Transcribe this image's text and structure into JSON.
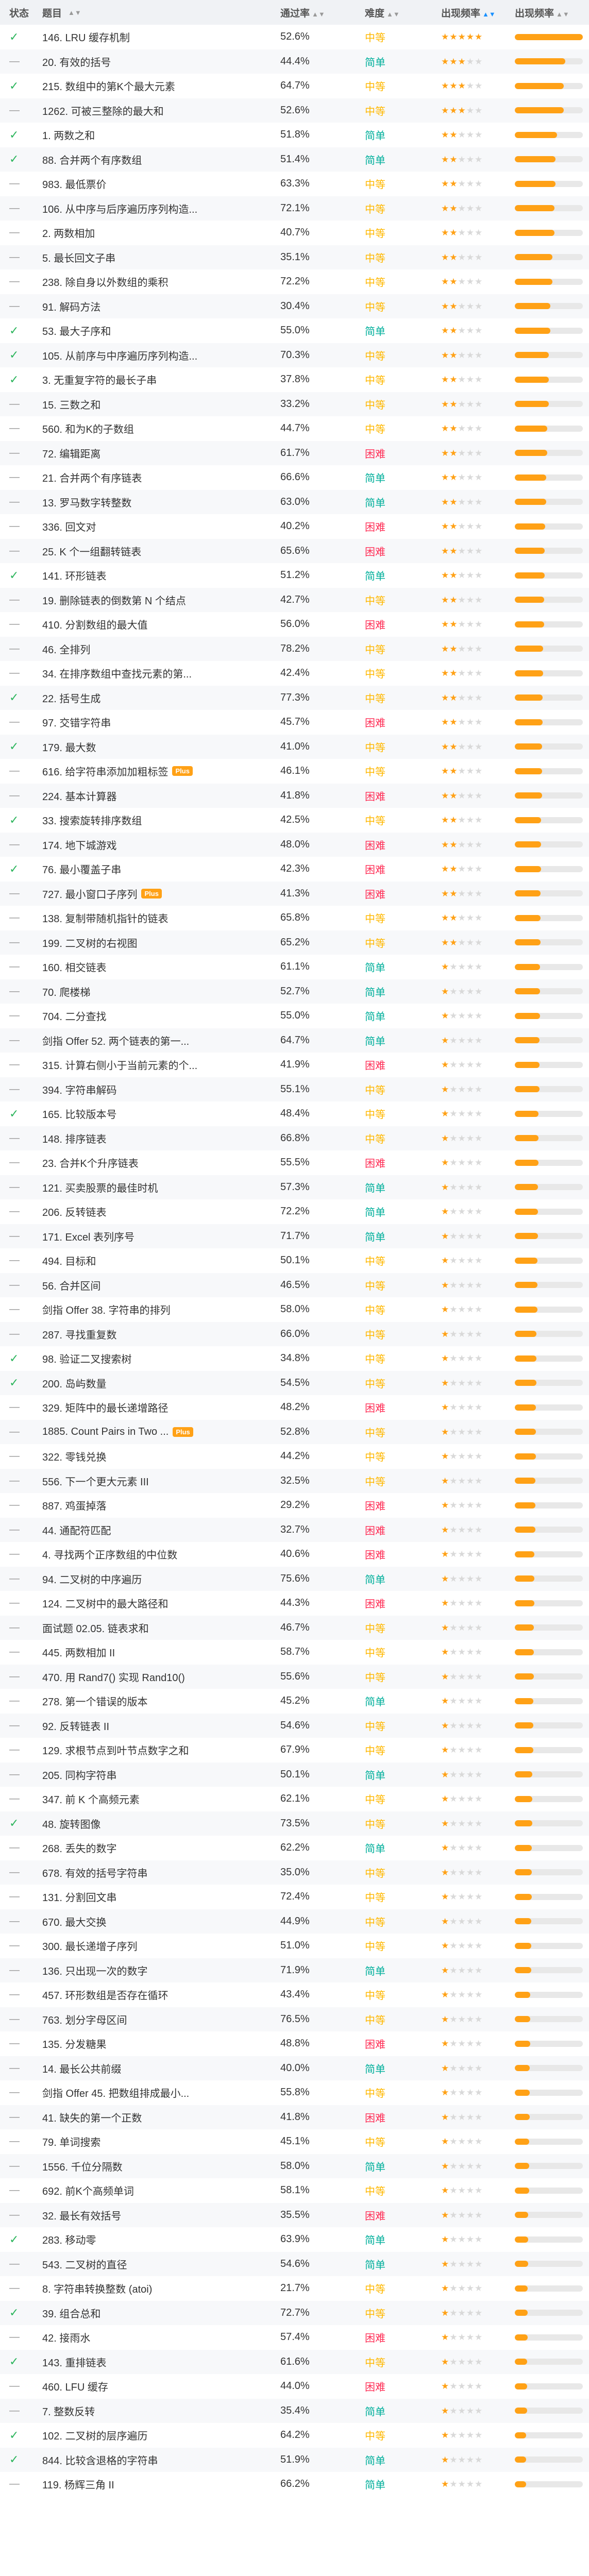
{
  "header": {
    "status": "状态",
    "title": "题目",
    "rate": "通过率",
    "difficulty": "难度",
    "frequency": "出现频率"
  },
  "icons": {
    "check": "check-icon",
    "dash": "dash-icon",
    "sort": "sort-icon",
    "plus": "plus-badge",
    "lock": "lock-icon",
    "star": "star-icon"
  },
  "colors": {
    "easy": "#00af9b",
    "medium": "#ffb800",
    "hard": "#ff2d55",
    "accent": "#ffa116",
    "check": "#2db55d"
  },
  "rows": [
    {
      "s": "check",
      "title": "146. LRU 缓存机制",
      "rate": "52.6%",
      "diff": "中等",
      "d": "medium",
      "stars": 5,
      "bar": 1.0
    },
    {
      "s": "dash",
      "title": "20. 有效的括号",
      "rate": "44.4%",
      "diff": "简单",
      "d": "easy",
      "stars": 3,
      "bar": 0.74
    },
    {
      "s": "check",
      "title": "215. 数组中的第K个最大元素",
      "rate": "64.7%",
      "diff": "中等",
      "d": "medium",
      "stars": 3,
      "bar": 0.72
    },
    {
      "s": "dash",
      "title": "1262. 可被三整除的最大和",
      "rate": "52.6%",
      "diff": "中等",
      "d": "medium",
      "stars": 3,
      "bar": 0.72
    },
    {
      "s": "check",
      "title": "1. 两数之和",
      "rate": "51.8%",
      "diff": "简单",
      "d": "easy",
      "stars": 2,
      "bar": 0.62
    },
    {
      "s": "check",
      "title": "88. 合并两个有序数组",
      "rate": "51.4%",
      "diff": "简单",
      "d": "easy",
      "stars": 2,
      "bar": 0.6
    },
    {
      "s": "dash",
      "title": "983. 最低票价",
      "rate": "63.3%",
      "diff": "中等",
      "d": "medium",
      "stars": 2,
      "bar": 0.6
    },
    {
      "s": "dash",
      "title": "106. 从中序与后序遍历序列构造...",
      "rate": "72.1%",
      "diff": "中等",
      "d": "medium",
      "stars": 2,
      "bar": 0.58
    },
    {
      "s": "dash",
      "title": "2. 两数相加",
      "rate": "40.7%",
      "diff": "中等",
      "d": "medium",
      "stars": 2,
      "bar": 0.58
    },
    {
      "s": "dash",
      "title": "5. 最长回文子串",
      "rate": "35.1%",
      "diff": "中等",
      "d": "medium",
      "stars": 2,
      "bar": 0.55
    },
    {
      "s": "dash",
      "title": "238. 除自身以外数组的乘积",
      "rate": "72.2%",
      "diff": "中等",
      "d": "medium",
      "stars": 2,
      "bar": 0.55
    },
    {
      "s": "dash",
      "title": "91. 解码方法",
      "rate": "30.4%",
      "diff": "中等",
      "d": "medium",
      "stars": 2,
      "bar": 0.52
    },
    {
      "s": "check",
      "title": "53. 最大子序和",
      "rate": "55.0%",
      "diff": "简单",
      "d": "easy",
      "stars": 2,
      "bar": 0.52
    },
    {
      "s": "check",
      "title": "105. 从前序与中序遍历序列构造...",
      "rate": "70.3%",
      "diff": "中等",
      "d": "medium",
      "stars": 2,
      "bar": 0.5
    },
    {
      "s": "check",
      "title": "3. 无重复字符的最长子串",
      "rate": "37.8%",
      "diff": "中等",
      "d": "medium",
      "stars": 2,
      "bar": 0.5
    },
    {
      "s": "dash",
      "title": "15. 三数之和",
      "rate": "33.2%",
      "diff": "中等",
      "d": "medium",
      "stars": 2,
      "bar": 0.5
    },
    {
      "s": "dash",
      "title": "560. 和为K的子数组",
      "rate": "44.7%",
      "diff": "中等",
      "d": "medium",
      "stars": 2,
      "bar": 0.48
    },
    {
      "s": "dash",
      "title": "72. 编辑距离",
      "rate": "61.7%",
      "diff": "困难",
      "d": "hard",
      "stars": 2,
      "bar": 0.48
    },
    {
      "s": "dash",
      "title": "21. 合并两个有序链表",
      "rate": "66.6%",
      "diff": "简单",
      "d": "easy",
      "stars": 2,
      "bar": 0.46
    },
    {
      "s": "dash",
      "title": "13. 罗马数字转整数",
      "rate": "63.0%",
      "diff": "简单",
      "d": "easy",
      "stars": 2,
      "bar": 0.46
    },
    {
      "s": "dash",
      "title": "336. 回文对",
      "rate": "40.2%",
      "diff": "困难",
      "d": "hard",
      "stars": 2,
      "bar": 0.45
    },
    {
      "s": "dash",
      "title": "25. K 个一组翻转链表",
      "rate": "65.6%",
      "diff": "困难",
      "d": "hard",
      "stars": 2,
      "bar": 0.44
    },
    {
      "s": "check",
      "title": "141. 环形链表",
      "rate": "51.2%",
      "diff": "简单",
      "d": "easy",
      "stars": 2,
      "bar": 0.44
    },
    {
      "s": "dash",
      "title": "19. 删除链表的倒数第 N 个结点",
      "rate": "42.7%",
      "diff": "中等",
      "d": "medium",
      "stars": 2,
      "bar": 0.43
    },
    {
      "s": "dash",
      "title": "410. 分割数组的最大值",
      "rate": "56.0%",
      "diff": "困难",
      "d": "hard",
      "stars": 2,
      "bar": 0.43
    },
    {
      "s": "dash",
      "title": "46. 全排列",
      "rate": "78.2%",
      "diff": "中等",
      "d": "medium",
      "stars": 2,
      "bar": 0.42
    },
    {
      "s": "dash",
      "title": "34. 在排序数组中查找元素的第...",
      "rate": "42.4%",
      "diff": "中等",
      "d": "medium",
      "stars": 2,
      "bar": 0.42
    },
    {
      "s": "check",
      "title": "22. 括号生成",
      "rate": "77.3%",
      "diff": "中等",
      "d": "medium",
      "stars": 2,
      "bar": 0.41
    },
    {
      "s": "dash",
      "title": "97. 交错字符串",
      "rate": "45.7%",
      "diff": "困难",
      "d": "hard",
      "stars": 2,
      "bar": 0.41
    },
    {
      "s": "check",
      "title": "179. 最大数",
      "rate": "41.0%",
      "diff": "中等",
      "d": "medium",
      "stars": 2,
      "bar": 0.4
    },
    {
      "s": "dash",
      "title": "616. 给字符串添加加粗标签",
      "plus": true,
      "rate": "46.1%",
      "diff": "中等",
      "d": "medium",
      "stars": 2,
      "bar": 0.4
    },
    {
      "s": "dash",
      "title": "224. 基本计算器",
      "rate": "41.8%",
      "diff": "困难",
      "d": "hard",
      "stars": 2,
      "bar": 0.4
    },
    {
      "s": "check",
      "title": "33. 搜索旋转排序数组",
      "rate": "42.5%",
      "diff": "中等",
      "d": "medium",
      "stars": 2,
      "bar": 0.39
    },
    {
      "s": "dash",
      "title": "174. 地下城游戏",
      "rate": "48.0%",
      "diff": "困难",
      "d": "hard",
      "stars": 2,
      "bar": 0.39
    },
    {
      "s": "check",
      "title": "76. 最小覆盖子串",
      "rate": "42.3%",
      "diff": "困难",
      "d": "hard",
      "stars": 2,
      "bar": 0.39
    },
    {
      "s": "dash",
      "title": "727. 最小窗口子序列",
      "plus": true,
      "rate": "41.3%",
      "diff": "困难",
      "d": "hard",
      "stars": 2,
      "bar": 0.38
    },
    {
      "s": "dash",
      "title": "138. 复制带随机指针的链表",
      "rate": "65.8%",
      "diff": "中等",
      "d": "medium",
      "stars": 2,
      "bar": 0.38
    },
    {
      "s": "dash",
      "title": "199. 二叉树的右视图",
      "rate": "65.2%",
      "diff": "中等",
      "d": "medium",
      "stars": 2,
      "bar": 0.38
    },
    {
      "s": "dash",
      "title": "160. 相交链表",
      "rate": "61.1%",
      "diff": "简单",
      "d": "easy",
      "stars": 1,
      "bar": 0.37
    },
    {
      "s": "dash",
      "title": "70. 爬楼梯",
      "rate": "52.7%",
      "diff": "简单",
      "d": "easy",
      "stars": 1,
      "bar": 0.37
    },
    {
      "s": "dash",
      "title": "704. 二分查找",
      "rate": "55.0%",
      "diff": "简单",
      "d": "easy",
      "stars": 1,
      "bar": 0.37
    },
    {
      "s": "dash",
      "title": "剑指 Offer 52. 两个链表的第一...",
      "rate": "64.7%",
      "diff": "简单",
      "d": "easy",
      "stars": 1,
      "bar": 0.36
    },
    {
      "s": "dash",
      "title": "315. 计算右侧小于当前元素的个...",
      "rate": "41.9%",
      "diff": "困难",
      "d": "hard",
      "stars": 1,
      "bar": 0.36
    },
    {
      "s": "dash",
      "title": "394. 字符串解码",
      "rate": "55.1%",
      "diff": "中等",
      "d": "medium",
      "stars": 1,
      "bar": 0.36
    },
    {
      "s": "check",
      "title": "165. 比较版本号",
      "rate": "48.4%",
      "diff": "中等",
      "d": "medium",
      "stars": 1,
      "bar": 0.35
    },
    {
      "s": "dash",
      "title": "148. 排序链表",
      "rate": "66.8%",
      "diff": "中等",
      "d": "medium",
      "stars": 1,
      "bar": 0.35
    },
    {
      "s": "dash",
      "title": "23. 合并K个升序链表",
      "rate": "55.5%",
      "diff": "困难",
      "d": "hard",
      "stars": 1,
      "bar": 0.35
    },
    {
      "s": "dash",
      "title": "121. 买卖股票的最佳时机",
      "rate": "57.3%",
      "diff": "简单",
      "d": "easy",
      "stars": 1,
      "bar": 0.34
    },
    {
      "s": "dash",
      "title": "206. 反转链表",
      "rate": "72.2%",
      "diff": "简单",
      "d": "easy",
      "stars": 1,
      "bar": 0.34
    },
    {
      "s": "dash",
      "title": "171. Excel 表列序号",
      "rate": "71.7%",
      "diff": "简单",
      "d": "easy",
      "stars": 1,
      "bar": 0.34
    },
    {
      "s": "dash",
      "title": "494. 目标和",
      "rate": "50.1%",
      "diff": "中等",
      "d": "medium",
      "stars": 1,
      "bar": 0.33
    },
    {
      "s": "dash",
      "title": "56. 合并区间",
      "rate": "46.5%",
      "diff": "中等",
      "d": "medium",
      "stars": 1,
      "bar": 0.33
    },
    {
      "s": "dash",
      "title": "剑指 Offer 38. 字符串的排列",
      "rate": "58.0%",
      "diff": "中等",
      "d": "medium",
      "stars": 1,
      "bar": 0.33
    },
    {
      "s": "dash",
      "title": "287. 寻找重复数",
      "rate": "66.0%",
      "diff": "中等",
      "d": "medium",
      "stars": 1,
      "bar": 0.32
    },
    {
      "s": "check",
      "title": "98. 验证二叉搜索树",
      "rate": "34.8%",
      "diff": "中等",
      "d": "medium",
      "stars": 1,
      "bar": 0.32
    },
    {
      "s": "check",
      "title": "200. 岛屿数量",
      "rate": "54.5%",
      "diff": "中等",
      "d": "medium",
      "stars": 1,
      "bar": 0.32
    },
    {
      "s": "dash",
      "title": "329. 矩阵中的最长递增路径",
      "rate": "48.2%",
      "diff": "困难",
      "d": "hard",
      "stars": 1,
      "bar": 0.31
    },
    {
      "s": "dash",
      "title": "1885. Count Pairs in Two ...",
      "plus": true,
      "rate": "52.8%",
      "diff": "中等",
      "d": "medium",
      "stars": 1,
      "bar": 0.31
    },
    {
      "s": "dash",
      "title": "322. 零钱兑换",
      "rate": "44.2%",
      "diff": "中等",
      "d": "medium",
      "stars": 1,
      "bar": 0.31
    },
    {
      "s": "dash",
      "title": "556. 下一个更大元素 III",
      "rate": "32.5%",
      "diff": "中等",
      "d": "medium",
      "stars": 1,
      "bar": 0.3
    },
    {
      "s": "dash",
      "title": "887. 鸡蛋掉落",
      "rate": "29.2%",
      "diff": "困难",
      "d": "hard",
      "stars": 1,
      "bar": 0.3
    },
    {
      "s": "dash",
      "title": "44. 通配符匹配",
      "rate": "32.7%",
      "diff": "困难",
      "d": "hard",
      "stars": 1,
      "bar": 0.3
    },
    {
      "s": "dash",
      "title": "4. 寻找两个正序数组的中位数",
      "rate": "40.6%",
      "diff": "困难",
      "d": "hard",
      "stars": 1,
      "bar": 0.29
    },
    {
      "s": "dash",
      "title": "94. 二叉树的中序遍历",
      "rate": "75.6%",
      "diff": "简单",
      "d": "easy",
      "stars": 1,
      "bar": 0.29
    },
    {
      "s": "dash",
      "title": "124. 二叉树中的最大路径和",
      "rate": "44.3%",
      "diff": "困难",
      "d": "hard",
      "stars": 1,
      "bar": 0.29
    },
    {
      "s": "dash",
      "title": "面试题 02.05. 链表求和",
      "rate": "46.7%",
      "diff": "中等",
      "d": "medium",
      "stars": 1,
      "bar": 0.28
    },
    {
      "s": "dash",
      "title": "445. 两数相加 II",
      "rate": "58.7%",
      "diff": "中等",
      "d": "medium",
      "stars": 1,
      "bar": 0.28
    },
    {
      "s": "dash",
      "title": "470. 用 Rand7() 实现 Rand10()",
      "rate": "55.6%",
      "diff": "中等",
      "d": "medium",
      "stars": 1,
      "bar": 0.28
    },
    {
      "s": "dash",
      "title": "278. 第一个错误的版本",
      "rate": "45.2%",
      "diff": "简单",
      "d": "easy",
      "stars": 1,
      "bar": 0.27
    },
    {
      "s": "dash",
      "title": "92. 反转链表 II",
      "rate": "54.6%",
      "diff": "中等",
      "d": "medium",
      "stars": 1,
      "bar": 0.27
    },
    {
      "s": "dash",
      "title": "129. 求根节点到叶节点数字之和",
      "rate": "67.9%",
      "diff": "中等",
      "d": "medium",
      "stars": 1,
      "bar": 0.27
    },
    {
      "s": "dash",
      "title": "205. 同构字符串",
      "rate": "50.1%",
      "diff": "简单",
      "d": "easy",
      "stars": 1,
      "bar": 0.26
    },
    {
      "s": "dash",
      "title": "347. 前 K 个高频元素",
      "rate": "62.1%",
      "diff": "中等",
      "d": "medium",
      "stars": 1,
      "bar": 0.26
    },
    {
      "s": "check",
      "title": "48. 旋转图像",
      "rate": "73.5%",
      "diff": "中等",
      "d": "medium",
      "stars": 1,
      "bar": 0.26
    },
    {
      "s": "dash",
      "title": "268. 丢失的数字",
      "rate": "62.2%",
      "diff": "简单",
      "d": "easy",
      "stars": 1,
      "bar": 0.25
    },
    {
      "s": "dash",
      "title": "678. 有效的括号字符串",
      "rate": "35.0%",
      "diff": "中等",
      "d": "medium",
      "stars": 1,
      "bar": 0.25
    },
    {
      "s": "dash",
      "title": "131. 分割回文串",
      "rate": "72.4%",
      "diff": "中等",
      "d": "medium",
      "stars": 1,
      "bar": 0.25
    },
    {
      "s": "dash",
      "title": "670. 最大交换",
      "rate": "44.9%",
      "diff": "中等",
      "d": "medium",
      "stars": 1,
      "bar": 0.24
    },
    {
      "s": "dash",
      "title": "300. 最长递增子序列",
      "rate": "51.0%",
      "diff": "中等",
      "d": "medium",
      "stars": 1,
      "bar": 0.24
    },
    {
      "s": "dash",
      "title": "136. 只出现一次的数字",
      "rate": "71.9%",
      "diff": "简单",
      "d": "easy",
      "stars": 1,
      "bar": 0.24
    },
    {
      "s": "dash",
      "title": "457. 环形数组是否存在循环",
      "rate": "43.4%",
      "diff": "中等",
      "d": "medium",
      "stars": 1,
      "bar": 0.23
    },
    {
      "s": "dash",
      "title": "763. 划分字母区间",
      "rate": "76.5%",
      "diff": "中等",
      "d": "medium",
      "stars": 1,
      "bar": 0.23
    },
    {
      "s": "dash",
      "title": "135. 分发糖果",
      "rate": "48.8%",
      "diff": "困难",
      "d": "hard",
      "stars": 1,
      "bar": 0.23
    },
    {
      "s": "dash",
      "title": "14. 最长公共前缀",
      "rate": "40.0%",
      "diff": "简单",
      "d": "easy",
      "stars": 1,
      "bar": 0.22
    },
    {
      "s": "dash",
      "title": "剑指 Offer 45. 把数组排成最小...",
      "rate": "55.8%",
      "diff": "中等",
      "d": "medium",
      "stars": 1,
      "bar": 0.22
    },
    {
      "s": "dash",
      "title": "41. 缺失的第一个正数",
      "rate": "41.8%",
      "diff": "困难",
      "d": "hard",
      "stars": 1,
      "bar": 0.22
    },
    {
      "s": "dash",
      "title": "79. 单词搜索",
      "rate": "45.1%",
      "diff": "中等",
      "d": "medium",
      "stars": 1,
      "bar": 0.21
    },
    {
      "s": "dash",
      "title": "1556. 千位分隔数",
      "rate": "58.0%",
      "diff": "简单",
      "d": "easy",
      "stars": 1,
      "bar": 0.21
    },
    {
      "s": "dash",
      "title": "692. 前K个高频单词",
      "rate": "58.1%",
      "diff": "中等",
      "d": "medium",
      "stars": 1,
      "bar": 0.21
    },
    {
      "s": "dash",
      "title": "32. 最长有效括号",
      "rate": "35.5%",
      "diff": "困难",
      "d": "hard",
      "stars": 1,
      "bar": 0.2
    },
    {
      "s": "check",
      "title": "283. 移动零",
      "rate": "63.9%",
      "diff": "简单",
      "d": "easy",
      "stars": 1,
      "bar": 0.2
    },
    {
      "s": "dash",
      "title": "543. 二叉树的直径",
      "rate": "54.6%",
      "diff": "简单",
      "d": "easy",
      "stars": 1,
      "bar": 0.2
    },
    {
      "s": "dash",
      "title": "8. 字符串转换整数 (atoi)",
      "rate": "21.7%",
      "diff": "中等",
      "d": "medium",
      "stars": 1,
      "bar": 0.19
    },
    {
      "s": "check",
      "title": "39. 组合总和",
      "rate": "72.7%",
      "diff": "中等",
      "d": "medium",
      "stars": 1,
      "bar": 0.19
    },
    {
      "s": "dash",
      "title": "42. 接雨水",
      "rate": "57.4%",
      "diff": "困难",
      "d": "hard",
      "stars": 1,
      "bar": 0.19
    },
    {
      "s": "check",
      "title": "143. 重排链表",
      "rate": "61.6%",
      "diff": "中等",
      "d": "medium",
      "stars": 1,
      "bar": 0.18
    },
    {
      "s": "dash",
      "title": "460. LFU 缓存",
      "rate": "44.0%",
      "diff": "困难",
      "d": "hard",
      "stars": 1,
      "bar": 0.18
    },
    {
      "s": "dash",
      "title": "7. 整数反转",
      "rate": "35.4%",
      "diff": "简单",
      "d": "easy",
      "stars": 1,
      "bar": 0.18
    },
    {
      "s": "check",
      "title": "102. 二叉树的层序遍历",
      "rate": "64.2%",
      "diff": "中等",
      "d": "medium",
      "stars": 1,
      "bar": 0.17
    },
    {
      "s": "check",
      "title": "844. 比较含退格的字符串",
      "rate": "51.9%",
      "diff": "简单",
      "d": "easy",
      "stars": 1,
      "bar": 0.17
    },
    {
      "s": "dash",
      "title": "119. 杨辉三角 II",
      "rate": "66.2%",
      "diff": "简单",
      "d": "easy",
      "stars": 1,
      "bar": 0.17
    }
  ]
}
